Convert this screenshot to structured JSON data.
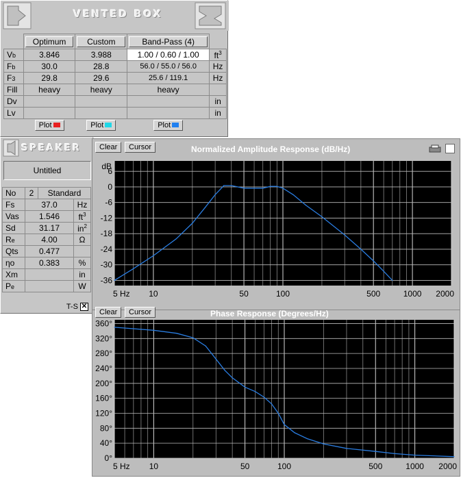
{
  "vented_box": {
    "title": "VENTED BOX",
    "columns": [
      "Optimum",
      "Custom",
      "Band-Pass (4)"
    ],
    "rows": [
      {
        "label": "Vb",
        "values": [
          "3.846",
          "3.988",
          "1.00 / 0.60 / 1.00"
        ],
        "unit": "ft3"
      },
      {
        "label": "Fb",
        "values": [
          "30.0",
          "28.8",
          "56.0 / 55.0 / 56.0"
        ],
        "unit": "Hz"
      },
      {
        "label": "F3",
        "values": [
          "29.8",
          "29.6",
          "25.6 / 119.1"
        ],
        "unit": "Hz"
      },
      {
        "label": "Fill",
        "values": [
          "heavy",
          "heavy",
          "heavy"
        ],
        "unit": ""
      },
      {
        "label": "Dv",
        "values": [
          "",
          "",
          ""
        ],
        "unit": "in"
      },
      {
        "label": "Lv",
        "values": [
          "",
          "",
          ""
        ],
        "unit": "in"
      }
    ],
    "plot_label": "Plot",
    "plot_colors": [
      "#e82020",
      "#20d8e8",
      "#2080f0"
    ]
  },
  "speaker": {
    "title": "SPEAKER",
    "name": "Untitled",
    "no_label": "No",
    "no_value": "2",
    "type": "Standard",
    "rows": [
      {
        "label": "Fs",
        "value": "37.0",
        "unit": "Hz"
      },
      {
        "label": "Vas",
        "value": "1.546",
        "unit": "ft3"
      },
      {
        "label": "Sd",
        "value": "31.17",
        "unit": "in2"
      },
      {
        "label": "Re",
        "value": "4.00",
        "unit": "Ω"
      },
      {
        "label": "Qts",
        "value": "0.477",
        "unit": ""
      },
      {
        "label": "ηo",
        "value": "0.383",
        "unit": "%"
      },
      {
        "label": "Xm",
        "value": "",
        "unit": "in"
      },
      {
        "label": "Pe",
        "value": "",
        "unit": "W"
      }
    ],
    "ts_label": "T-S",
    "ts_checked": true
  },
  "amplitude_window": {
    "clear_label": "Clear",
    "cursor_label": "Cursor",
    "title": "Normalized Amplitude Response (dB/Hz)",
    "unit_label": "dB",
    "x_ticks": [
      "5 Hz",
      "10",
      "50",
      "100",
      "500",
      "1000",
      "2000"
    ],
    "y_ticks": [
      "6",
      "0",
      "-6",
      "-12",
      "-18",
      "-24",
      "-30",
      "-36"
    ]
  },
  "phase_window": {
    "clear_label": "Clear",
    "cursor_label": "Cursor",
    "title": "Phase Response (Degrees/Hz)",
    "x_ticks": [
      "5 Hz",
      "10",
      "50",
      "100",
      "500",
      "1000",
      "2000"
    ],
    "y_ticks": [
      "360°",
      "320°",
      "280°",
      "240°",
      "200°",
      "160°",
      "120°",
      "80°",
      "40°",
      "0°"
    ]
  },
  "chart_data": [
    {
      "type": "line",
      "title": "Normalized Amplitude Response (dB/Hz)",
      "xlabel": "",
      "ylabel": "dB",
      "xscale": "log",
      "xlim": [
        5,
        2000
      ],
      "ylim": [
        -38,
        10
      ],
      "grid": true,
      "series": [
        {
          "color": "#2a7de1",
          "x": [
            5,
            7,
            10,
            15,
            20,
            25,
            30,
            35,
            40,
            50,
            60,
            70,
            80,
            90,
            100,
            120,
            150,
            200,
            300,
            400,
            500,
            600,
            700
          ],
          "y": [
            -36,
            -31.5,
            -26.5,
            -20,
            -14,
            -8,
            -3,
            0.5,
            0.5,
            -0.5,
            -0.5,
            -0.5,
            0.2,
            0.2,
            -0.5,
            -3,
            -7,
            -11.5,
            -18.5,
            -24,
            -28.5,
            -32.5,
            -36
          ]
        }
      ]
    },
    {
      "type": "line",
      "title": "Phase Response (Degrees/Hz)",
      "xlabel": "",
      "ylabel": "",
      "xscale": "log",
      "xlim": [
        5,
        2000
      ],
      "ylim": [
        0,
        370
      ],
      "grid": true,
      "series": [
        {
          "color": "#2a7de1",
          "x": [
            5,
            10,
            15,
            20,
            25,
            30,
            35,
            40,
            50,
            60,
            70,
            80,
            90,
            100,
            120,
            150,
            200,
            300,
            500,
            700,
            1000,
            2000
          ],
          "y": [
            350,
            342,
            334,
            322,
            300,
            265,
            235,
            215,
            190,
            178,
            163,
            145,
            120,
            90,
            68,
            52,
            38,
            26,
            18,
            12,
            8,
            4
          ]
        }
      ]
    }
  ]
}
